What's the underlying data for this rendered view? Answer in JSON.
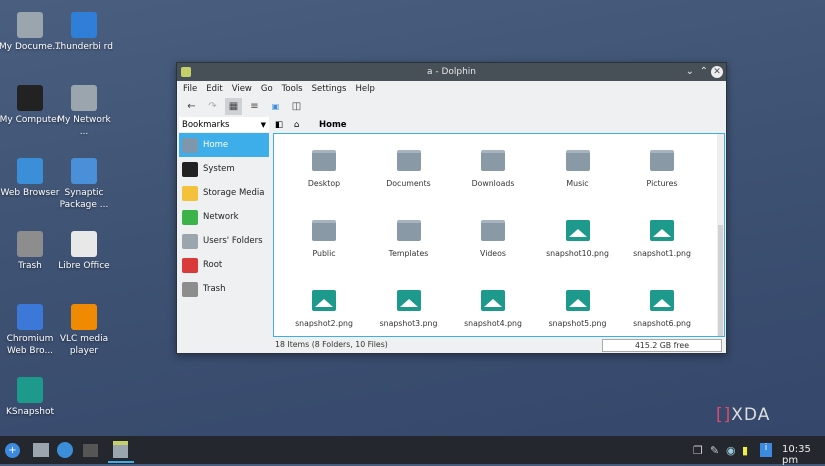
{
  "desktop": {
    "icons": [
      {
        "label": "My Docume...",
        "color": "#9aa5ae"
      },
      {
        "label": "Thunderbi rd",
        "color": "#2f7ed8"
      },
      {
        "label": "My Computer",
        "color": "#222"
      },
      {
        "label": "My Network ...",
        "color": "#9aa5ae"
      },
      {
        "label": "Web Browser",
        "color": "#3a8fd8"
      },
      {
        "label": "Synaptic Package ...",
        "color": "#4a90d9"
      },
      {
        "label": "Trash",
        "color": "#8d8d8d"
      },
      {
        "label": "Libre Office",
        "color": "#e8e8e8"
      },
      {
        "label": "Chromium Web Bro...",
        "color": "#3b78d8"
      },
      {
        "label": "VLC media player",
        "color": "#f08a00"
      },
      {
        "label": "KSnapshot",
        "color": "#1d9a8c"
      }
    ]
  },
  "window": {
    "title": "a - Dolphin",
    "menu": [
      "File",
      "Edit",
      "View",
      "Go",
      "Tools",
      "Settings",
      "Help"
    ],
    "places_label": "Bookmarks",
    "breadcrumb": "Home",
    "places": [
      {
        "label": "Home",
        "color": "#7f97ad"
      },
      {
        "label": "System",
        "color": "#222"
      },
      {
        "label": "Storage Media",
        "color": "#f3c13a"
      },
      {
        "label": "Network",
        "color": "#3bb34a"
      },
      {
        "label": "Users' Folders",
        "color": "#9aa5ae"
      },
      {
        "label": "Root",
        "color": "#d93b3b"
      },
      {
        "label": "Trash",
        "color": "#8d8d8d"
      }
    ],
    "files": [
      {
        "name": "Desktop",
        "type": "folder"
      },
      {
        "name": "Documents",
        "type": "folder"
      },
      {
        "name": "Downloads",
        "type": "folder"
      },
      {
        "name": "Music",
        "type": "folder"
      },
      {
        "name": "Pictures",
        "type": "folder"
      },
      {
        "name": "Public",
        "type": "folder"
      },
      {
        "name": "Templates",
        "type": "folder"
      },
      {
        "name": "Videos",
        "type": "folder"
      },
      {
        "name": "snapshot10.png",
        "type": "image"
      },
      {
        "name": "snapshot1.png",
        "type": "image"
      },
      {
        "name": "snapshot2.png",
        "type": "image"
      },
      {
        "name": "snapshot3.png",
        "type": "image"
      },
      {
        "name": "snapshot4.png",
        "type": "image"
      },
      {
        "name": "snapshot5.png",
        "type": "image"
      },
      {
        "name": "snapshot6.png",
        "type": "image"
      }
    ],
    "status": "18 Items (8 Folders, 10 Files)",
    "free": "415.2 GB free"
  },
  "watermark": "XDA",
  "taskbar": {
    "clock": "10:35 pm"
  }
}
